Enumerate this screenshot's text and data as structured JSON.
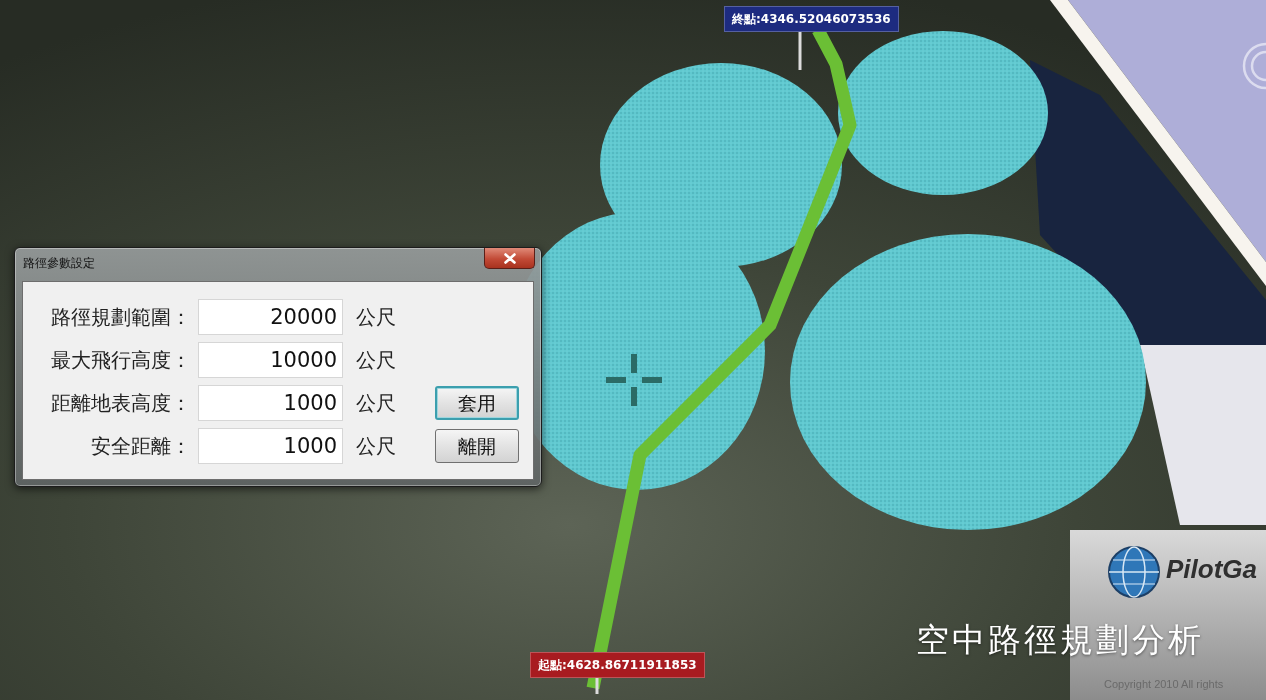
{
  "scene": {
    "markers": [
      {
        "label": "終點:4346.52046073536",
        "color": "#1d2b80"
      },
      {
        "label": "起點:4628.86711911853",
        "color": "#a81b20"
      }
    ],
    "logo_panel": {
      "brand": "PilotGa",
      "copyright": "Copyright 2010 All rights"
    }
  },
  "dialog": {
    "title": "路徑參數設定",
    "fields": [
      {
        "label": "路徑規劃範圍：",
        "value": "20000",
        "unit": "公尺"
      },
      {
        "label": "最大飛行高度：",
        "value": "10000",
        "unit": "公尺"
      },
      {
        "label": "距離地表高度：",
        "value": "1000",
        "unit": "公尺"
      },
      {
        "label": "安全距離：",
        "value": "1000",
        "unit": "公尺"
      }
    ],
    "buttons": [
      {
        "label": "套用",
        "focused": true
      },
      {
        "label": "離開",
        "focused": false
      }
    ]
  },
  "caption": "空中路徑規劃分析"
}
